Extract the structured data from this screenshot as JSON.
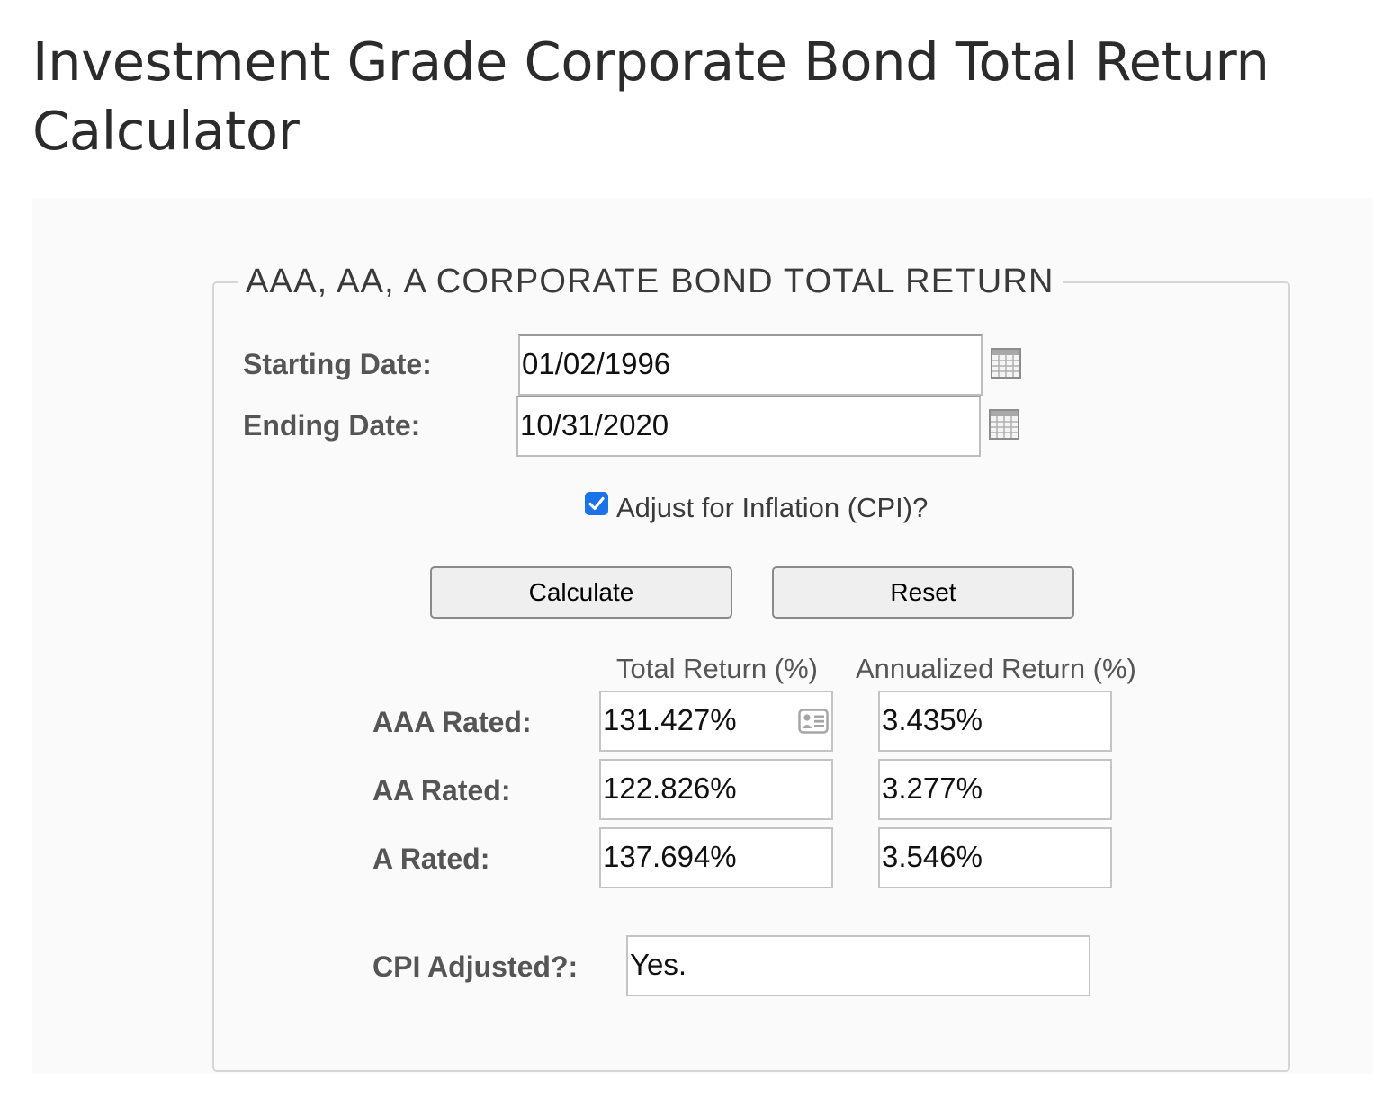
{
  "page": {
    "title": "Investment Grade Corporate Bond Total Return Calculator"
  },
  "calculator": {
    "legend": "AAA, AA, A CORPORATE BOND TOTAL RETURN",
    "starting_date": {
      "label": "Starting Date:",
      "value": "01/02/1996",
      "icon": "calendar-icon"
    },
    "ending_date": {
      "label": "Ending Date:",
      "value": "10/31/2020",
      "icon": "calendar-icon"
    },
    "inflation": {
      "label": "Adjust for Inflation (CPI)?",
      "checked": true
    },
    "buttons": {
      "calculate": "Calculate",
      "reset": "Reset"
    }
  },
  "results": {
    "total_return_header": "Total Return (%)",
    "annualized_return_header": "Annualized Return (%)",
    "rows": [
      {
        "label": "AAA Rated:",
        "total": "131.427%",
        "annualized": "3.435%"
      },
      {
        "label": "AA Rated:",
        "total": "122.826%",
        "annualized": "3.277%"
      },
      {
        "label": "A Rated:",
        "total": "137.694%",
        "annualized": "3.546%"
      }
    ],
    "autofill_icon": "contact-card-icon",
    "cpi_adjusted": {
      "label": "CPI Adjusted?:",
      "value": "Yes."
    }
  },
  "colors": {
    "checkbox_accent": "#1a73e8",
    "panel_background": "#fafafa",
    "button_background": "#efefef"
  }
}
